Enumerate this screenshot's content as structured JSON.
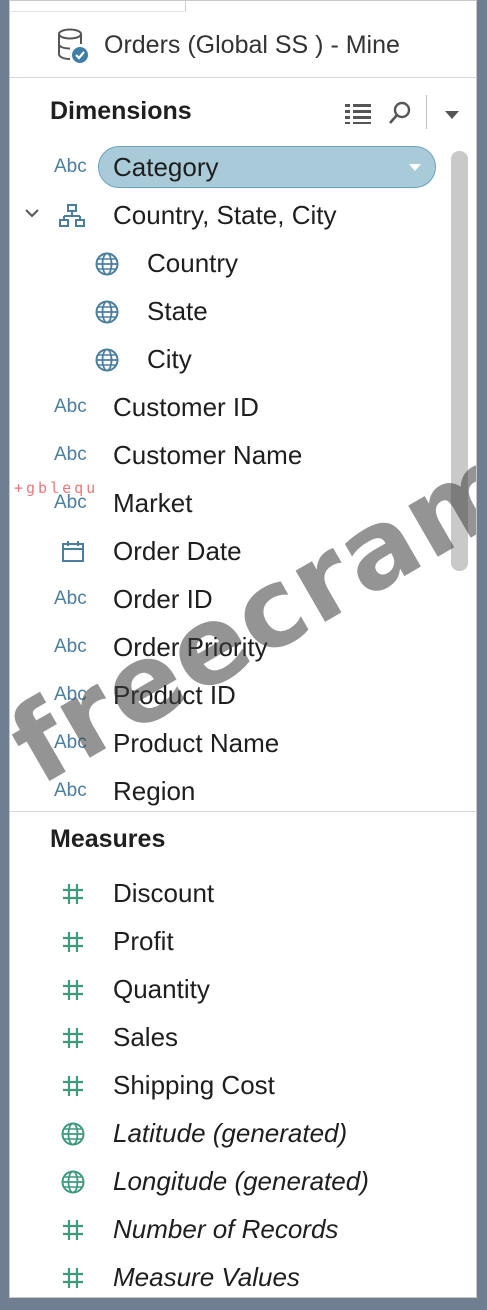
{
  "datasource": {
    "name": "Orders (Global SS ) - Mine",
    "icon": "database-check-icon"
  },
  "dimensions": {
    "title": "Dimensions",
    "tools": [
      "list-view-icon",
      "search-icon",
      "dropdown-caret-icon"
    ],
    "fields": [
      {
        "label": "Category",
        "type": "abc",
        "type_label": "Abc",
        "selected": true
      },
      {
        "label": "Country, State, City",
        "type": "hierarchy",
        "expanded": true
      },
      {
        "label": "Country",
        "type": "geo",
        "indent": true
      },
      {
        "label": "State",
        "type": "geo",
        "indent": true
      },
      {
        "label": "City",
        "type": "geo",
        "indent": true
      },
      {
        "label": "Customer ID",
        "type": "abc",
        "type_label": "Abc"
      },
      {
        "label": "Customer Name",
        "type": "abc",
        "type_label": "Abc"
      },
      {
        "label": "Market",
        "type": "abc",
        "type_label": "Abc"
      },
      {
        "label": "Order Date",
        "type": "date"
      },
      {
        "label": "Order ID",
        "type": "abc",
        "type_label": "Abc"
      },
      {
        "label": "Order Priority",
        "type": "abc",
        "type_label": "Abc"
      },
      {
        "label": "Product ID",
        "type": "abc",
        "type_label": "Abc"
      },
      {
        "label": "Product Name",
        "type": "abc",
        "type_label": "Abc"
      },
      {
        "label": "Region",
        "type": "abc",
        "type_label": "Abc"
      }
    ]
  },
  "measures": {
    "title": "Measures",
    "fields": [
      {
        "label": "Discount",
        "type": "number"
      },
      {
        "label": "Profit",
        "type": "number"
      },
      {
        "label": "Quantity",
        "type": "number"
      },
      {
        "label": "Sales",
        "type": "number"
      },
      {
        "label": "Shipping Cost",
        "type": "number"
      },
      {
        "label": "Latitude (generated)",
        "type": "geo",
        "italic": true
      },
      {
        "label": "Longitude (generated)",
        "type": "geo",
        "italic": true
      },
      {
        "label": "Number of Records",
        "type": "number",
        "italic": true
      },
      {
        "label": "Measure Values",
        "type": "number",
        "italic": true
      }
    ]
  },
  "watermark": {
    "text": "freecram.net",
    "small": "+gblequ"
  },
  "colors": {
    "dimension_icon": "#4a7ea0",
    "measure_icon": "#3f9a7c",
    "selected_pill": "#a9cbd9"
  }
}
